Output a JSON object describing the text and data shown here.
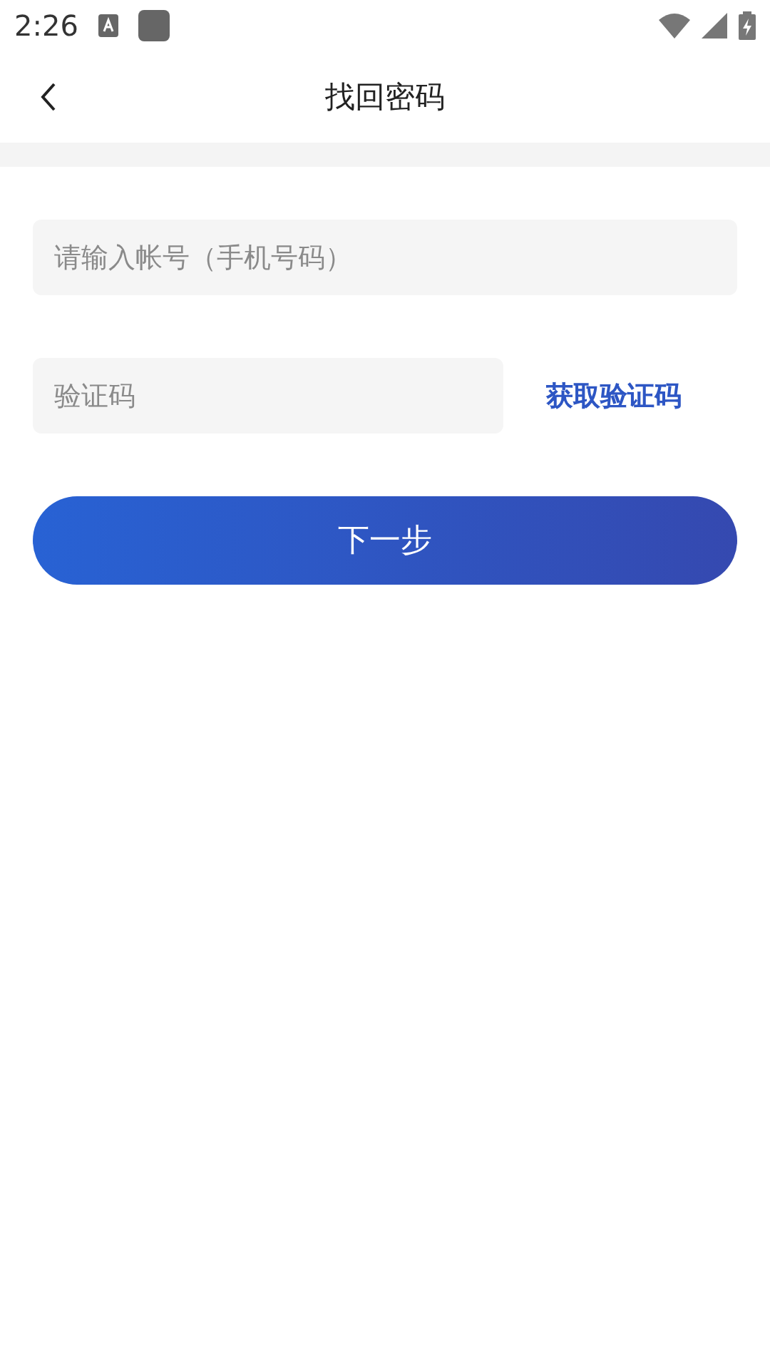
{
  "status_bar": {
    "time": "2:26"
  },
  "header": {
    "title": "找回密码"
  },
  "account_field": {
    "placeholder": "请输入帐号（手机号码）"
  },
  "code_field": {
    "placeholder": "验证码"
  },
  "get_code_link": "获取验证码",
  "next_button": "下一步"
}
